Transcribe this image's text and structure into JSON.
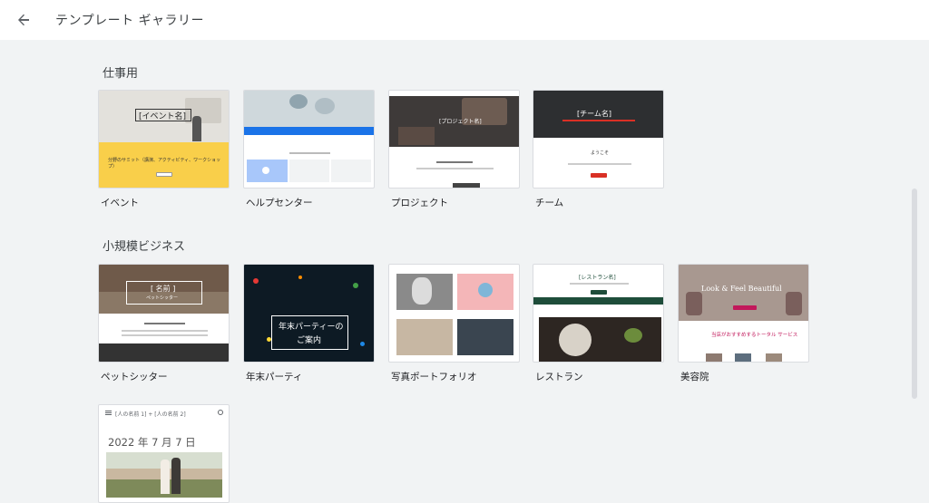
{
  "header": {
    "title": "テンプレート ギャラリー",
    "back_icon": "arrow-back-icon"
  },
  "sections": {
    "work": {
      "title": "仕事用",
      "templates": [
        {
          "label": "イベント",
          "thumb_title": "[イベント名]",
          "thumb_caption": "分野のサミット（講演、アクティビティ、ワークショップ）"
        },
        {
          "label": "ヘルプセンター"
        },
        {
          "label": "プロジェクト",
          "thumb_title": "[プロジェクト名]"
        },
        {
          "label": "チーム",
          "thumb_title": "[チーム名]",
          "thumb_caption": "ようこそ"
        }
      ]
    },
    "small_business": {
      "title": "小規模ビジネス",
      "templates": [
        {
          "label": "ペットシッター",
          "thumb_title": "[ 名前 ]",
          "thumb_subtitle": "ペットシッター"
        },
        {
          "label": "年末パーティ",
          "thumb_title": "年末パーティーの",
          "thumb_subtitle": "ご案内"
        },
        {
          "label": "写真ポートフォリオ"
        },
        {
          "label": "レストラン",
          "thumb_title": "[レストラン名]"
        },
        {
          "label": "美容院",
          "thumb_title": "Look & Feel Beautiful",
          "thumb_caption": "当店がおすすめするトータル サービス"
        }
      ]
    },
    "personal": {
      "templates": [
        {
          "thumb_header": "[人の名前 1] + [人の名前 2]",
          "thumb_date": "2022 年 7 月 7 日"
        }
      ]
    }
  },
  "colors": {
    "background": "#f1f3f4",
    "topbar": "#ffffff",
    "event_yellow": "#f9cf4a",
    "help_blue": "#1a73e8",
    "team_red": "#d93025",
    "restaurant_green": "#1e4d3a",
    "salon_pink": "#c2185b"
  }
}
